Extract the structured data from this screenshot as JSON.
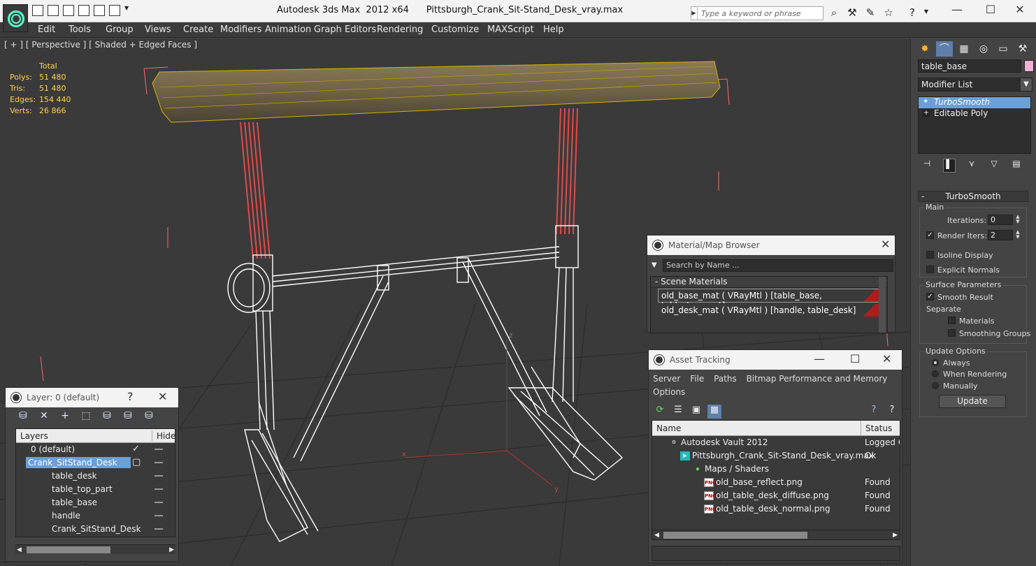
{
  "titlebar": {
    "app_name": "Autodesk 3ds Max  2012 x64",
    "file_name": "Pittsburgh_Crank_Sit-Stand_Desk_vray.max",
    "search_placeholder": "Type a keyword or phrase",
    "minimize": "—",
    "maximize": "☐",
    "close": "✕"
  },
  "menubar": [
    "Edit",
    "Tools",
    "Group",
    "Views",
    "Create",
    "Modifiers",
    "Animation",
    "Graph Editors",
    "Rendering",
    "Customize",
    "MAXScript",
    "Help"
  ],
  "viewport": {
    "label": "[ + ] [ Perspective ] [ Shaded + Edged Faces ]",
    "stats": {
      "total_label": "Total",
      "rows": [
        {
          "k": "Polys:",
          "v": "51 480"
        },
        {
          "k": "Tris:",
          "v": "51 480"
        },
        {
          "k": "Edges:",
          "v": "154 440"
        },
        {
          "k": "Verts:",
          "v": "26 866"
        }
      ]
    },
    "axis_z": "z",
    "axis_x": "x",
    "axis_y": "y"
  },
  "command_panel": {
    "object_name": "table_base",
    "object_color": "#f0b0d8",
    "modifier_list": "Modifier List",
    "stack": [
      "TurboSmooth",
      "Editable Poly"
    ],
    "turbosmooth": {
      "title": "TurboSmooth",
      "main_label": "Main",
      "iterations_label": "Iterations:",
      "iterations": "0",
      "render_iters_label": "Render Iters:",
      "render_iters": "2",
      "isoline_display": "Isoline Display",
      "explicit_normals": "Explicit Normals",
      "surface_params_label": "Surface Parameters",
      "smooth_result": "Smooth Result",
      "separate_label": "Separate",
      "materials": "Materials",
      "smoothing_groups": "Smoothing Groups",
      "update_options_label": "Update Options",
      "always": "Always",
      "when_rendering": "When Rendering",
      "manually": "Manually",
      "update_button": "Update"
    }
  },
  "layer_window": {
    "title": "Layer: 0 (default)",
    "help": "?",
    "close": "✕",
    "col_layers": "Layers",
    "col_hide": "Hide",
    "rows": [
      "0 (default)",
      "Crank_SitStand_Desk",
      "table_desk",
      "table_top_part",
      "table_base",
      "handle",
      "Crank_SitStand_Desk"
    ]
  },
  "material_browser": {
    "title": "Material/Map Browser",
    "close": "✕",
    "search_placeholder": "Search by Name ...",
    "section": "- Scene Materials",
    "materials": [
      "old_base_mat  ( VRayMtl ) [table_base, table_top_part]",
      "old_desk_mat  ( VRayMtl ) [handle, table_desk]"
    ]
  },
  "asset_tracking": {
    "title": "Asset Tracking",
    "minimize": "—",
    "maximize": "☐",
    "close": "✕",
    "menu": [
      "Server",
      "File",
      "Paths",
      "Bitmap Performance and Memory",
      "Options"
    ],
    "col_name": "Name",
    "col_status": "Status",
    "rows": [
      {
        "name": "Autodesk Vault 2012",
        "status": "Logged O"
      },
      {
        "name": "Pittsburgh_Crank_Sit-Stand_Desk_vray.max",
        "status": "Ok"
      },
      {
        "name": "Maps / Shaders",
        "status": ""
      },
      {
        "name": "old_base_reflect.png",
        "status": "Found"
      },
      {
        "name": "old_table_desk_diffuse.png",
        "status": "Found"
      },
      {
        "name": "old_table_desk_normal.png",
        "status": "Found"
      }
    ],
    "png_badge": "PNG"
  }
}
